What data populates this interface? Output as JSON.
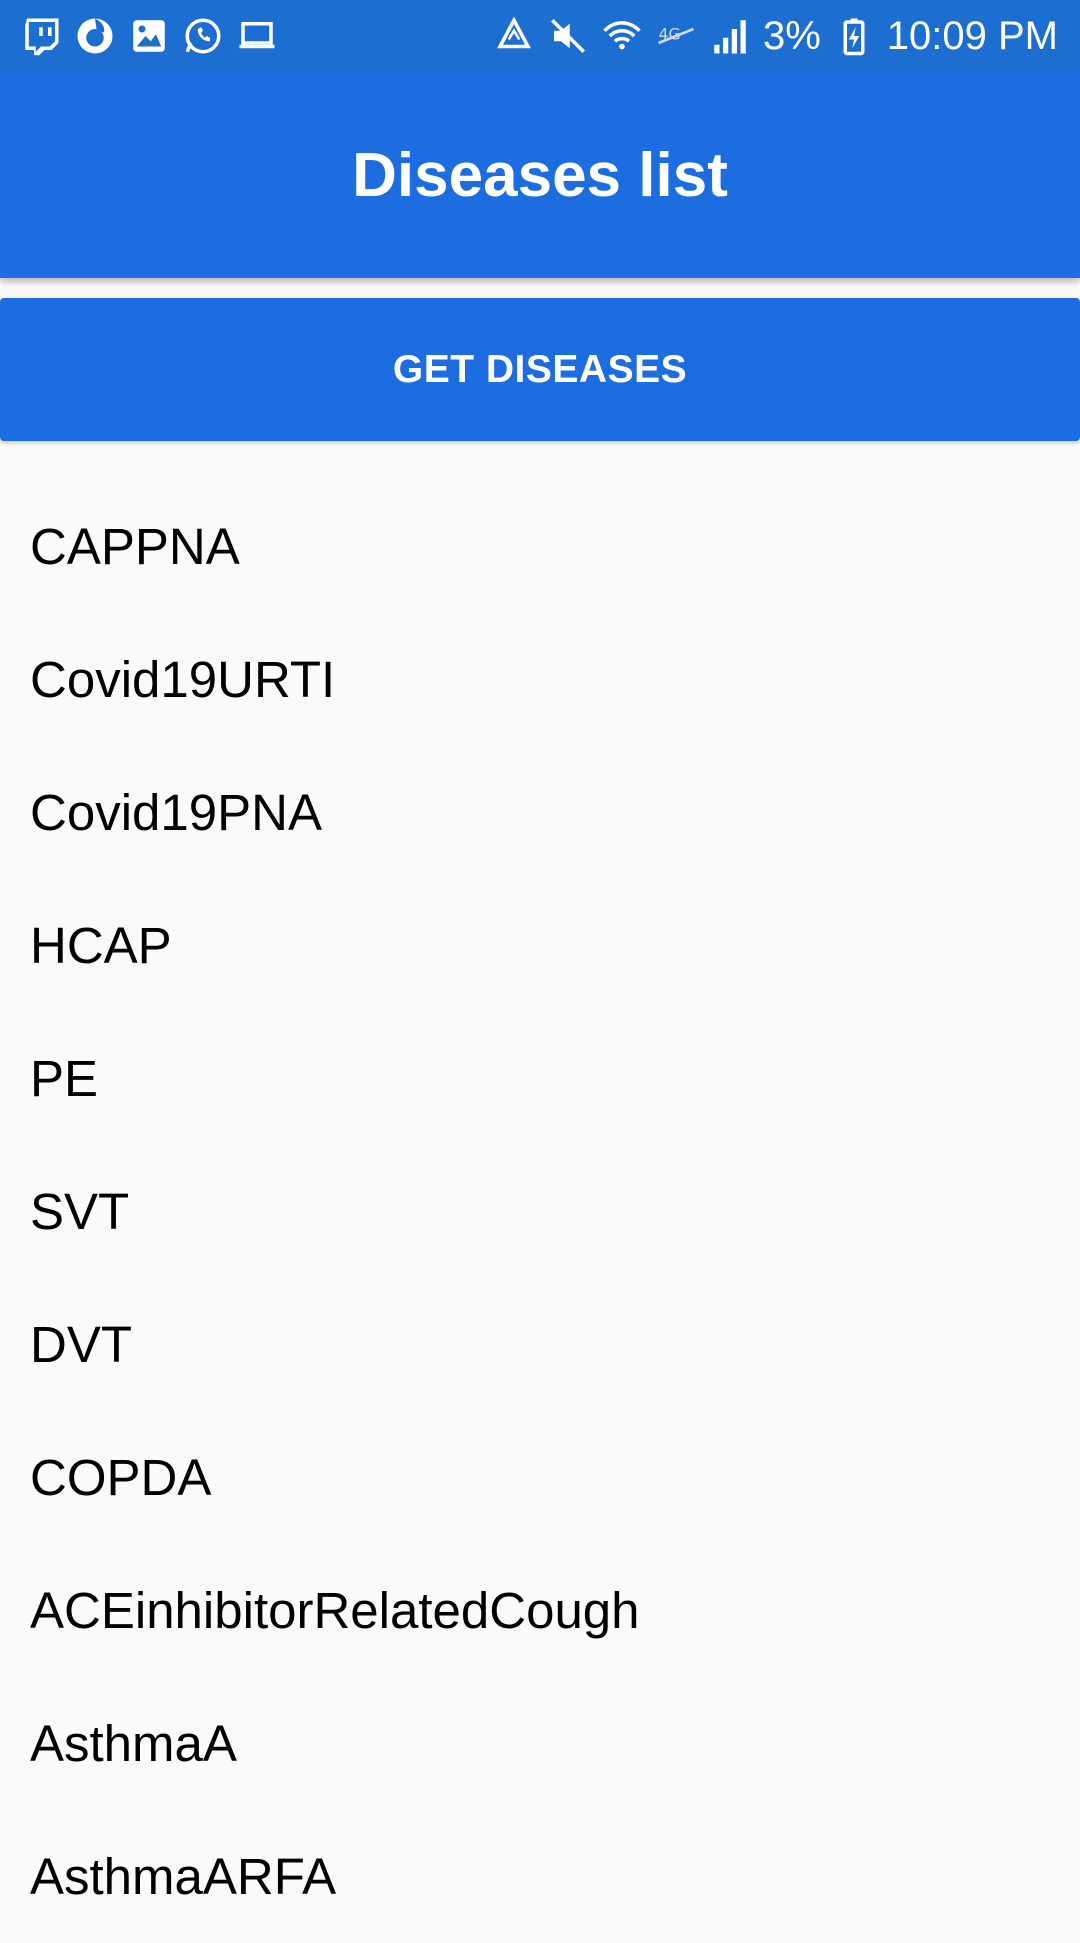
{
  "status_bar": {
    "left_icons": [
      "twitch-icon",
      "firefox-icon",
      "image-icon",
      "whatsapp-icon",
      "laptop-icon"
    ],
    "right_icons": [
      "recycle-icon",
      "mute-icon",
      "wifi-icon",
      "lte-icon",
      "signal-icon"
    ],
    "battery_percent": "3%",
    "time": "10:09 PM",
    "colors": {
      "background": "#1c6fd0",
      "foreground": "#ffffff"
    }
  },
  "app_bar": {
    "title": "Diseases list",
    "color": "#1c6de0"
  },
  "actions": {
    "get_diseases_label": "GET DISEASES"
  },
  "diseases": [
    "CAPPNA",
    "Covid19URTI",
    "Covid19PNA",
    "HCAP",
    "PE",
    "SVT",
    "DVT",
    "COPDA",
    "ACEinhibitorRelatedCough",
    "AsthmaA",
    "AsthmaARFA"
  ]
}
